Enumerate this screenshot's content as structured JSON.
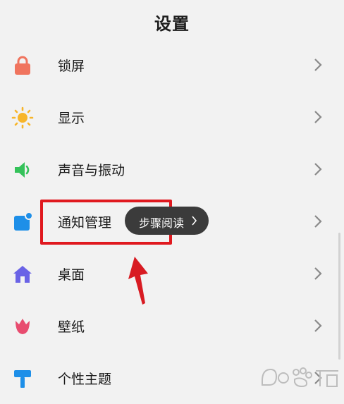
{
  "header": {
    "title": "设置"
  },
  "settings": {
    "items": [
      {
        "label": "锁屏",
        "icon": "lock-icon",
        "color": "#f0745e"
      },
      {
        "label": "显示",
        "icon": "sun-icon",
        "color": "#f7b52a"
      },
      {
        "label": "声音与振动",
        "icon": "speaker-icon",
        "color": "#35c25a"
      },
      {
        "label": "通知管理",
        "icon": "notification-icon",
        "color": "#1e8fe8"
      },
      {
        "label": "桌面",
        "icon": "home-icon",
        "color": "#6a63e6"
      },
      {
        "label": "壁纸",
        "icon": "tulip-icon",
        "color": "#e84c6f"
      },
      {
        "label": "个性主题",
        "icon": "paint-roller-icon",
        "color": "#1e8fe8"
      }
    ]
  },
  "tooltip": {
    "label": "步骤阅读"
  },
  "annotation": {
    "highlight_color": "#e0191f",
    "arrow_color": "#d81b22"
  },
  "watermark": {
    "icon": "baidu-jingyan-watermark"
  }
}
